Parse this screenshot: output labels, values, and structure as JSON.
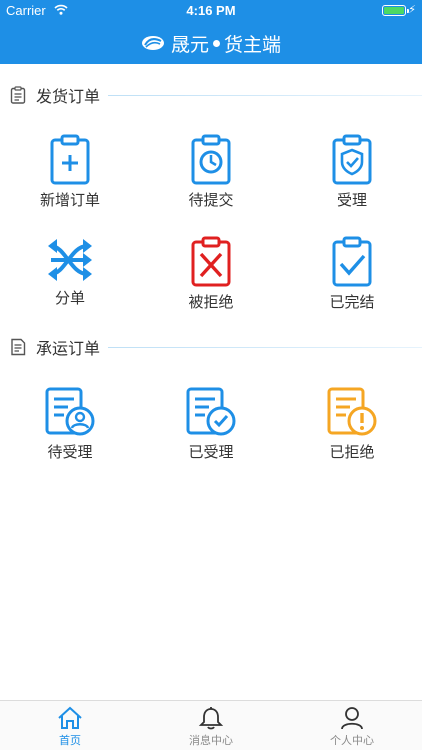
{
  "status_bar": {
    "carrier": "Carrier",
    "time": "4:16 PM"
  },
  "nav": {
    "title_main": "晟元",
    "title_sub": "货主端"
  },
  "sections": [
    {
      "title": "发货订单",
      "items": [
        {
          "label": "新增订单",
          "icon": "clipboard-plus-icon",
          "color": "#1e8fe6"
        },
        {
          "label": "待提交",
          "icon": "clipboard-clock-icon",
          "color": "#1e8fe6"
        },
        {
          "label": "受理",
          "icon": "clipboard-shield-icon",
          "color": "#1e8fe6"
        },
        {
          "label": "分单",
          "icon": "shuffle-arrows-icon",
          "color": "#1e8fe6"
        },
        {
          "label": "被拒绝",
          "icon": "clipboard-x-icon",
          "color": "#e02020"
        },
        {
          "label": "已完结",
          "icon": "clipboard-check-icon",
          "color": "#1e8fe6"
        }
      ]
    },
    {
      "title": "承运订单",
      "items": [
        {
          "label": "待受理",
          "icon": "document-person-icon",
          "color": "#1e8fe6"
        },
        {
          "label": "已受理",
          "icon": "document-check-icon",
          "color": "#1e8fe6"
        },
        {
          "label": "已拒绝",
          "icon": "document-alert-icon",
          "color": "#f5a623"
        }
      ]
    }
  ],
  "tabs": [
    {
      "label": "首页",
      "icon": "home-icon",
      "active": true
    },
    {
      "label": "消息中心",
      "icon": "bell-icon",
      "active": false
    },
    {
      "label": "个人中心",
      "icon": "person-icon",
      "active": false
    }
  ],
  "colors": {
    "primary": "#1e8fe6",
    "danger": "#e02020",
    "warning": "#f5a623",
    "battery": "#4cd964"
  }
}
